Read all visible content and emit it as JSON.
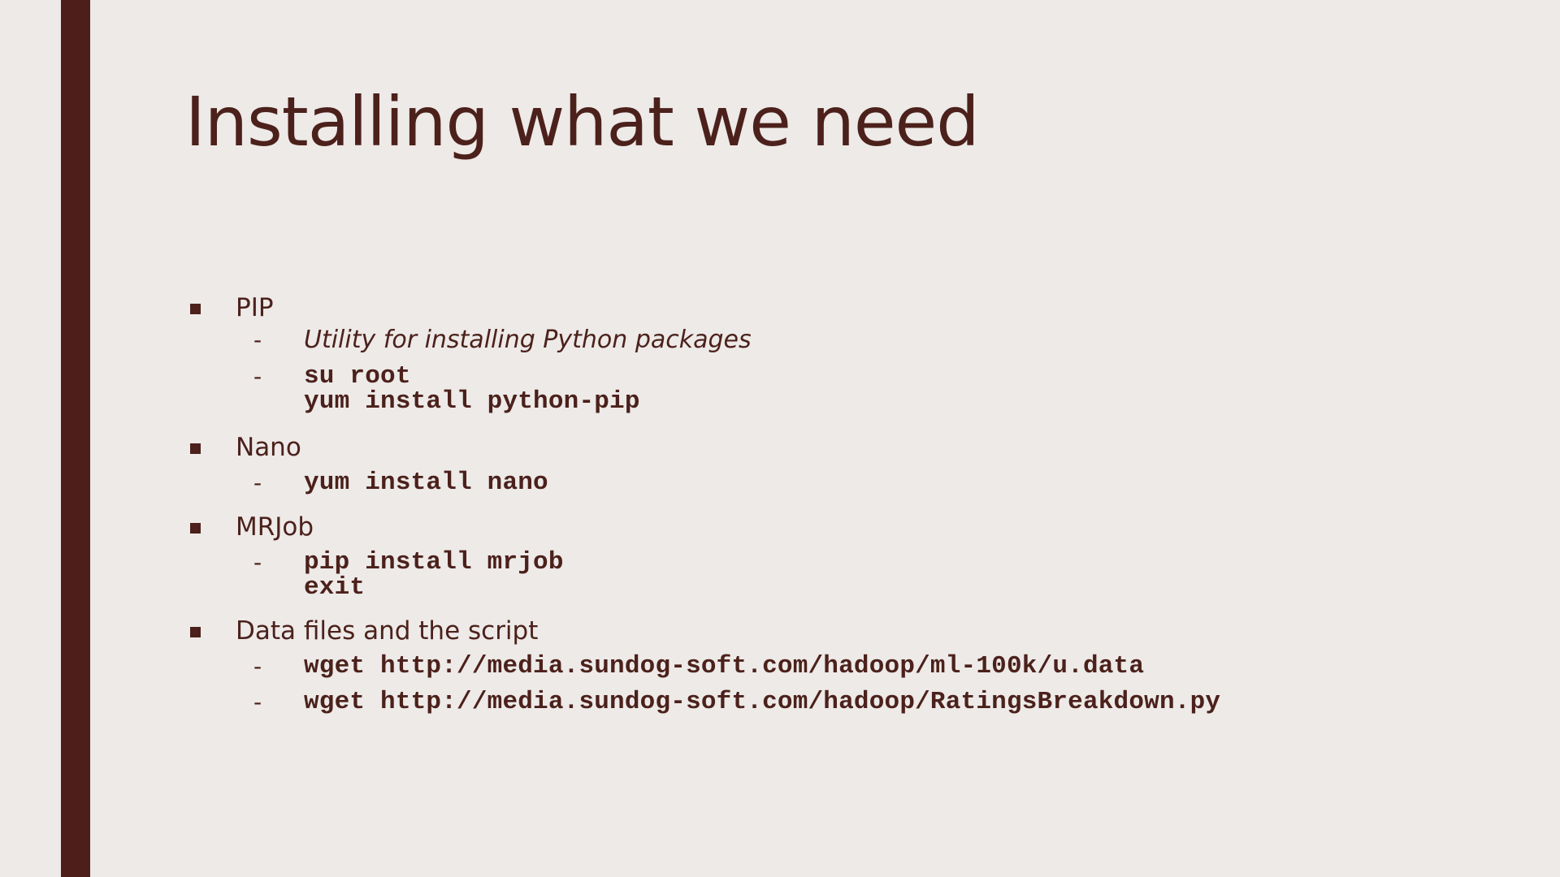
{
  "slide": {
    "title": "Installing what we need",
    "bullets": [
      {
        "label": "PIP",
        "subs": [
          {
            "text": "Utility for installing Python packages",
            "style": "italic"
          },
          {
            "text": "su root\nyum install python-pip",
            "style": "code"
          }
        ]
      },
      {
        "label": "Nano",
        "subs": [
          {
            "text": "yum install nano",
            "style": "code"
          }
        ]
      },
      {
        "label": "MRJob",
        "subs": [
          {
            "text": "pip install mrjob\nexit",
            "style": "code"
          }
        ]
      },
      {
        "label": "Data files and the script",
        "subs": [
          {
            "text": "wget http://media.sundog-soft.com/hadoop/ml-100k/u.data",
            "style": "code"
          },
          {
            "text": "wget http://media.sundog-soft.com/hadoop/RatingsBreakdown.py",
            "style": "code"
          }
        ]
      }
    ],
    "colors": {
      "background": "#edeae8",
      "accent": "#4e1f1a",
      "text": "#4c211b"
    }
  }
}
